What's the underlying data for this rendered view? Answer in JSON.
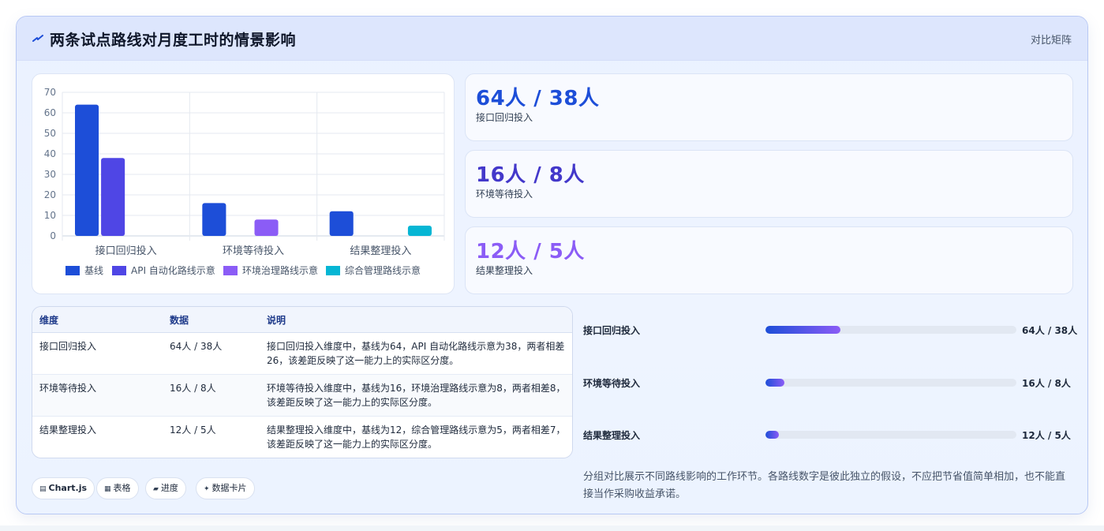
{
  "header": {
    "title": "两条试点路线对月度工时的情景影响",
    "action_label": "对比矩阵",
    "logo_icon": "spark-bolt-icon",
    "accent_color": "#1d4ed8"
  },
  "chart_data": {
    "type": "bar",
    "categories": [
      "接口回归投入",
      "环境等待投入",
      "结果整理投入"
    ],
    "series": [
      {
        "name": "基线",
        "color": "#1d4ed8",
        "values": [
          64,
          16,
          12
        ]
      },
      {
        "name": "API 自动化路线示意",
        "color": "#4f46e5",
        "values": [
          38,
          null,
          null
        ]
      },
      {
        "name": "环境治理路线示意",
        "color": "#8b5cf6",
        "values": [
          null,
          8,
          null
        ]
      },
      {
        "name": "综合管理路线示意",
        "color": "#06b6d4",
        "values": [
          null,
          null,
          5
        ]
      }
    ],
    "yticks": [
      "70",
      "60",
      "50",
      "40",
      "30",
      "20",
      "10",
      "0"
    ],
    "ylim": [
      0,
      70
    ],
    "grid": true,
    "legend_position": "bottom",
    "xlabel": "",
    "ylabel": ""
  },
  "kpis": [
    {
      "value": "64人 / 38人",
      "label": "接口回归投入",
      "color": "#1d4ed8"
    },
    {
      "value": "16人 / 8人",
      "label": "环境等待投入",
      "color": "#4338ca"
    },
    {
      "value": "12人 / 5人",
      "label": "结果整理投入",
      "color": "#8b5cf6"
    }
  ],
  "table": {
    "headers": [
      "维度",
      "数据",
      "说明"
    ],
    "rows": [
      [
        "接口回归投入",
        "64人 / 38人",
        "接口回归投入维度中，基线为64，API 自动化路线示意为38，两者相差26，该差距反映了这一能力上的实际区分度。"
      ],
      [
        "环境等待投入",
        "16人 / 8人",
        "环境等待投入维度中，基线为16，环境治理路线示意为8，两者相差8，该差距反映了这一能力上的实际区分度。"
      ],
      [
        "结果整理投入",
        "12人 / 5人",
        "结果整理投入维度中，基线为12，综合管理路线示意为5，两者相差7，该差距反映了这一能力上的实际区分度。"
      ]
    ]
  },
  "progress": [
    {
      "label": "接口回归投入",
      "value": "64人 / 38人",
      "fill_percent": 30
    },
    {
      "label": "环境等待投入",
      "value": "16人 / 8人",
      "fill_percent": 7.5
    },
    {
      "label": "结果整理投入",
      "value": "12人 / 5人",
      "fill_percent": 5.5
    }
  ],
  "pills": [
    {
      "icon": "chart-icon",
      "glyph": "▤",
      "label": "Chart.js"
    },
    {
      "icon": "table-icon",
      "glyph": "▦",
      "label": "表格"
    },
    {
      "icon": "progress-icon",
      "glyph": "▰",
      "label": "进度"
    },
    {
      "icon": "sparkle-icon",
      "glyph": "✦",
      "label": "数据卡片"
    }
  ],
  "note": "分组对比展示不同路线影响的工作环节。各路线数字是彼此独立的假设，不应把节省值简单相加，也不能直接当作采购收益承诺。"
}
